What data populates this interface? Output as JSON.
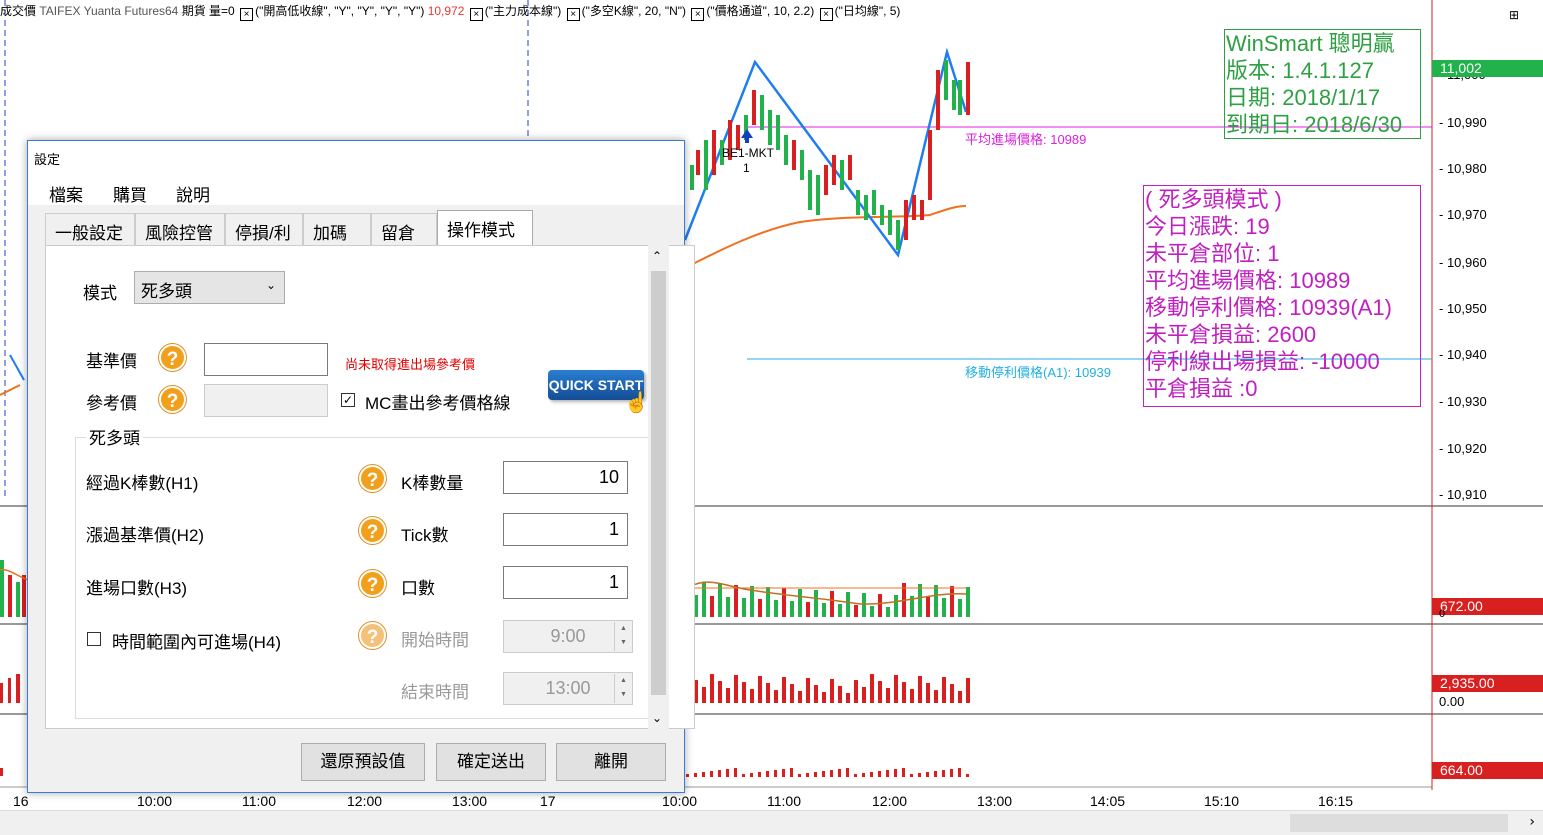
{
  "header": {
    "prefix": "成交價",
    "exchange": "TAIFEX",
    "account": "Yuanta Futures64",
    "type": "期貨",
    "volume": "量=0",
    "ind1": "(\"開高低收線\", \"Y\", \"Y\", \"Y\", \"Y\")",
    "ind1_value": "10,972",
    "ind2": "(\"主力成本線\")",
    "ind3": "(\"多空K線\", 20, \"N\")",
    "ind4": "(\"價格通道\", 10, 2.2)",
    "ind5": "(\"日均線\", 5)",
    "corner_icon": "panel-toggle-icon"
  },
  "winsmart": {
    "line1": "WinSmart 聰明贏",
    "line2": "版本: 1.4.1.127",
    "line3": "日期: 2018/1/17",
    "line4": "到期日: 2018/6/30"
  },
  "mode_box": {
    "title": "( 死多頭模式 )",
    "l1": "今日漲跌: 19",
    "l2": "未平倉部位: 1",
    "l3": "平均進場價格: 10989",
    "l4": "移動停利價格: 10939(A1)",
    "l5": "未平倉損益: 2600",
    "l6": "停利線出場損益: -10000",
    "l7": "平倉損益 :0"
  },
  "chart_labels": {
    "avg_entry": "平均進場價格: 10989",
    "trail_stop": "移動停利價格(A1): 10939",
    "trade": "BE1-MKT",
    "trade_qty": "1"
  },
  "price_axis": [
    "11,000",
    "10,990",
    "10,980",
    "10,970",
    "10,960",
    "10,950",
    "10,940",
    "10,930",
    "10,920",
    "10,910"
  ],
  "tags": {
    "last": "11,002",
    "vol": "672.00",
    "ind2": "2,935.00",
    "ind2_zero": "0.00",
    "ind3": "664.00",
    "vol_sub": "0"
  },
  "time_axis": [
    "16",
    "10:00",
    "11:00",
    "12:00",
    "13:00",
    "17",
    "10:00",
    "11:00",
    "12:00",
    "13:00",
    "14:05",
    "15:10",
    "16:15"
  ],
  "colors": {
    "up": "#d92020",
    "down": "#21b24b",
    "zigzag": "#1e7ef0",
    "avg": "#f07020",
    "magenta": "#e020e0",
    "cyan": "#20b0e0"
  },
  "dialog": {
    "title": "設定",
    "menu": [
      "檔案",
      "購買",
      "說明"
    ],
    "tabs": [
      "一般設定",
      "風險控管",
      "停損/利",
      "加碼",
      "留倉",
      "操作模式"
    ],
    "mode_label": "模式",
    "mode_value": "死多頭",
    "quick_start": "QUICK START",
    "base_label": "基準價",
    "base_value": "",
    "warn": "尚未取得進出場參考價",
    "ref_label": "參考價",
    "ref_value": "",
    "mc_draw": "MC畫出參考價格線",
    "group_title": "死多頭",
    "h1_label": "經過K棒數(H1)",
    "h1_param": "K棒數量",
    "h1_value": "10",
    "h2_label": "漲過基準價(H2)",
    "h2_param": "Tick數",
    "h2_value": "1",
    "h3_label": "進場口數(H3)",
    "h3_param": "口數",
    "h3_value": "1",
    "h4_label": "時間範圍內可進場(H4)",
    "start_label": "開始時間",
    "start_value": "9:00",
    "end_label": "結束時間",
    "end_value": "13:00",
    "btn_reset": "還原預設值",
    "btn_ok": "確定送出",
    "btn_exit": "離開"
  }
}
